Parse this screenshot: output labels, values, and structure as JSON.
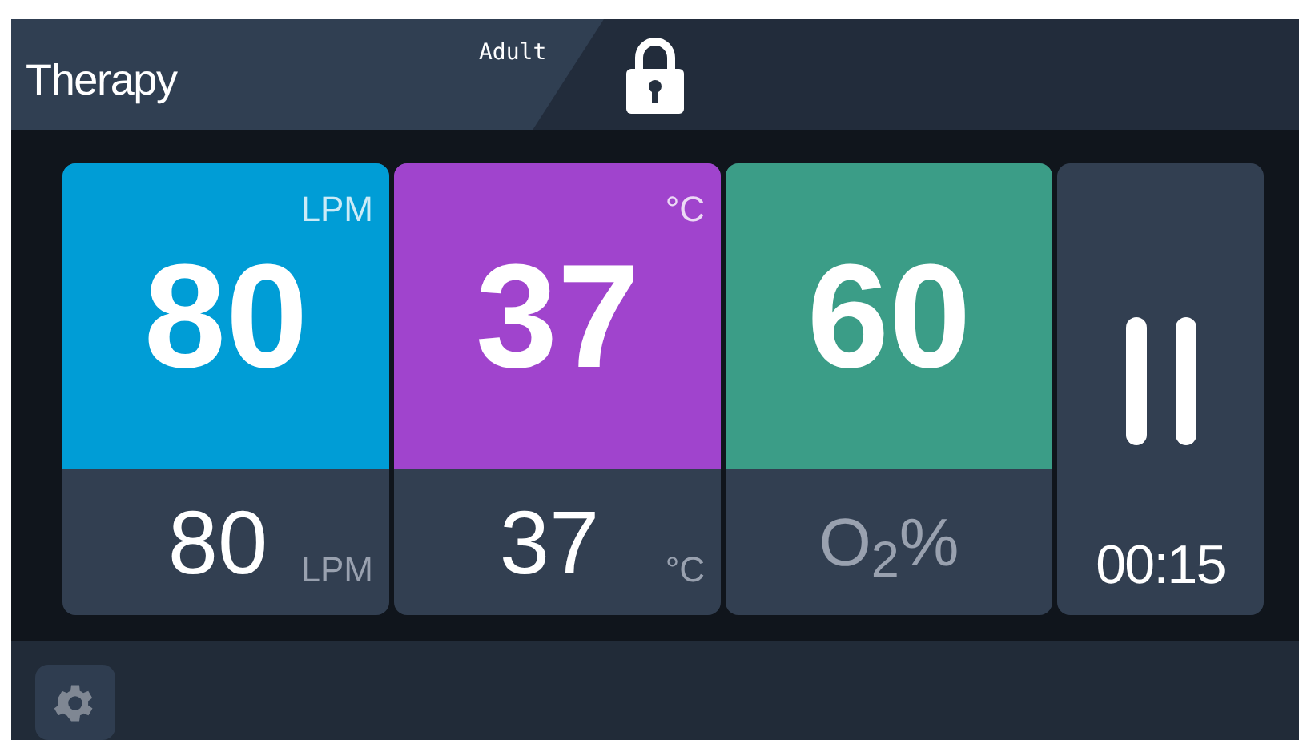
{
  "header": {
    "title": "Therapy",
    "mode": "Adult",
    "locked": true
  },
  "cards": [
    {
      "kind": "reading",
      "color": "#009dd6",
      "setpoint": "80",
      "setpoint_unit": "LPM",
      "current": "80",
      "current_unit": "LPM"
    },
    {
      "kind": "reading",
      "color": "#a044cd",
      "setpoint": "37",
      "setpoint_unit": "°C",
      "current": "37",
      "current_unit": "°C"
    },
    {
      "kind": "label",
      "color": "#3b9d87",
      "setpoint": "60",
      "label": "O$_{2}$%"
    }
  ],
  "control": {
    "running": true,
    "timer": "00:15"
  }
}
